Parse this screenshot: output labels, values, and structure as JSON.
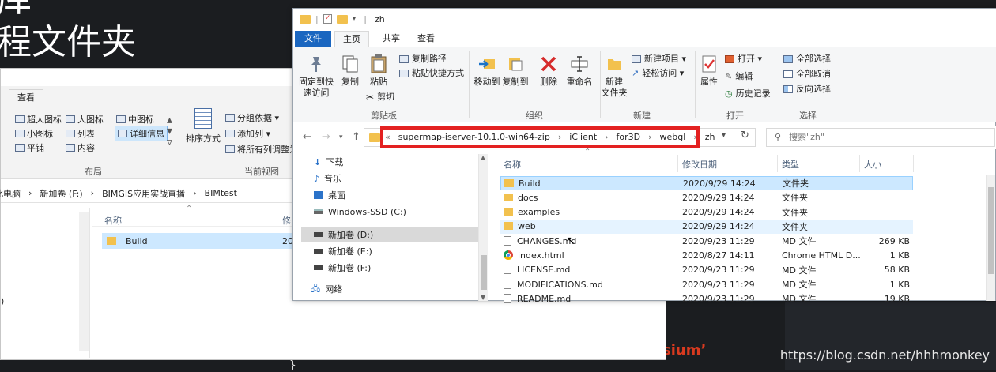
{
  "background": {
    "slide_title_line1": "库",
    "slide_title_line2": "程文件夹",
    "code_text": "sium’",
    "code_brace": "}",
    "watermark": "https://blog.csdn.net/hhhmonkey"
  },
  "back_window": {
    "tab": "查看",
    "layout_items": [
      "超大图标",
      "大图标",
      "中图标",
      "小图标",
      "列表",
      "详细信息",
      "平铺",
      "内容"
    ],
    "sort_label": "排序方式",
    "view_items": [
      "分组依据 ▾",
      "添加列 ▾",
      "将所有列调整为"
    ],
    "group_layout": "布局",
    "group_current_view": "当前视图",
    "breadcrumb": [
      "此电脑",
      "新加卷 (F:)",
      "BIMGIS应用实战直播",
      "BIMtest"
    ],
    "col_name": "名称",
    "col_modified": "修",
    "row_name": "Build",
    "row_date": "20",
    "left_fragment": ")"
  },
  "front_window": {
    "title": "zh",
    "tabs": {
      "file": "文件",
      "home": "主页",
      "share": "共享",
      "view": "查看"
    },
    "ribbon": {
      "pin": "固定到快\n速访问",
      "copy": "复制",
      "paste": "粘贴",
      "copy_path": "复制路径",
      "paste_shortcut": "粘贴快捷方式",
      "cut": "剪切",
      "group_clipboard": "剪贴板",
      "move_to": "移动到",
      "copy_to": "复制到",
      "delete": "删除",
      "rename": "重命名",
      "group_organize": "组织",
      "new_folder": "新建\n文件夹",
      "new_item": "新建项目 ▾",
      "easy_access": "轻松访问 ▾",
      "group_new": "新建",
      "properties": "属性",
      "open": "打开 ▾",
      "edit": "编辑",
      "history": "历史记录",
      "group_open": "打开",
      "select_all": "全部选择",
      "select_none": "全部取消",
      "invert": "反向选择",
      "group_select": "选择"
    },
    "address": {
      "prefix": "«",
      "crumbs": [
        "supermap-iserver-10.1.0-win64-zip",
        "iClient",
        "for3D",
        "webgl",
        "zh"
      ],
      "search_placeholder": "搜索\"zh\""
    },
    "nav": [
      {
        "label": "下载",
        "icon": "download-icon"
      },
      {
        "label": "音乐",
        "icon": "music-icon"
      },
      {
        "label": "桌面",
        "icon": "desktop-icon"
      },
      {
        "label": "Windows-SSD (C:)",
        "icon": "drive-icon"
      },
      {
        "label": "新加卷 (D:)",
        "icon": "drive-icon"
      },
      {
        "label": "新加卷 (E:)",
        "icon": "drive-icon"
      },
      {
        "label": "新加卷 (F:)",
        "icon": "drive-icon"
      },
      {
        "label": "网络",
        "icon": "network-icon"
      }
    ],
    "columns": {
      "name": "名称",
      "modified": "修改日期",
      "type": "类型",
      "size": "大小"
    },
    "files": [
      {
        "name": "Build",
        "date": "2020/9/29 14:24",
        "type": "文件夹",
        "size": "",
        "kind": "folder"
      },
      {
        "name": "docs",
        "date": "2020/9/29 14:24",
        "type": "文件夹",
        "size": "",
        "kind": "folder"
      },
      {
        "name": "examples",
        "date": "2020/9/29 14:24",
        "type": "文件夹",
        "size": "",
        "kind": "folder"
      },
      {
        "name": "web",
        "date": "2020/9/29 14:24",
        "type": "文件夹",
        "size": "",
        "kind": "folder"
      },
      {
        "name": "CHANGES.md",
        "date": "2020/9/23 11:29",
        "type": "MD 文件",
        "size": "269 KB",
        "kind": "doc"
      },
      {
        "name": "index.html",
        "date": "2020/8/27 14:11",
        "type": "Chrome HTML D...",
        "size": "1 KB",
        "kind": "chrome"
      },
      {
        "name": "LICENSE.md",
        "date": "2020/9/23 11:29",
        "type": "MD 文件",
        "size": "58 KB",
        "kind": "doc"
      },
      {
        "name": "MODIFICATIONS.md",
        "date": "2020/9/23 11:29",
        "type": "MD 文件",
        "size": "1 KB",
        "kind": "doc"
      },
      {
        "name": "README.md",
        "date": "2020/9/23 11:29",
        "type": "MD 文件",
        "size": "19 KB",
        "kind": "doc"
      }
    ]
  }
}
